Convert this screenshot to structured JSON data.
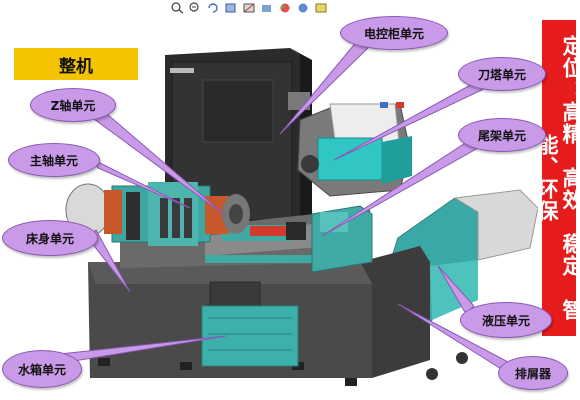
{
  "title": "整机",
  "banner": "定位：高精、高效、稳定、智能、环保",
  "callouts": {
    "cabinet": "电控柜单元",
    "turret": "刀塔单元",
    "zaxis": "Z轴单元",
    "tailstock": "尾架单元",
    "spindle": "主轴单元",
    "bed": "床身单元",
    "hydraulic": "液压单元",
    "tank": "水箱单元",
    "chip": "排屑器"
  },
  "toolbar_icons": [
    "zoom-in-icon",
    "zoom-out-icon",
    "rotate-icon",
    "view-cube-icon",
    "section-icon",
    "display-style-icon",
    "appearance-icon",
    "scene-icon",
    "render-icon"
  ],
  "colors": {
    "title_bg": "#f5c400",
    "banner_bg": "#e61b1b",
    "callout_fill": "#c89ae8",
    "cabinet": "#2c2c2c",
    "bed": "#4f4f4f",
    "teal": "#4fb6b0",
    "orange": "#c8582a"
  }
}
